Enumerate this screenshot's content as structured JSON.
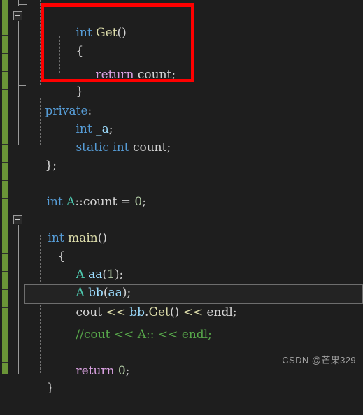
{
  "app": {
    "name": "visual-studio-code-editor",
    "theme": "dark",
    "background": "#1E1E1E"
  },
  "colors": {
    "background": "#1E1E1E",
    "keyword": "#569CD6",
    "function": "#DCDCAA",
    "class": "#4EC9B0",
    "identifier": "#D4D4D4",
    "variable": "#9CDCFE",
    "control_keyword": "#D8A0DF",
    "number": "#B5CEA8",
    "comment": "#57A64A",
    "annotation": "#FF0000",
    "changed_lines_marker": "#6A9437",
    "current_line_border": "#6E6E6E",
    "outline_marker": "#9A9A9A"
  },
  "gutter": {
    "change_marker_label": "unsaved-changes-bar",
    "outline_markers": [
      {
        "label": "collapse-class-A",
        "state": "expanded",
        "glyph": "minus"
      },
      {
        "label": "collapse-main",
        "state": "expanded",
        "glyph": "minus"
      }
    ]
  },
  "code": {
    "language": "cpp",
    "lines": [
      {
        "indent": 1,
        "text": "int Get()"
      },
      {
        "indent": 1,
        "text": "{"
      },
      {
        "indent": 2,
        "text": "return count;"
      },
      {
        "indent": 1,
        "text": "}"
      },
      {
        "indent": 0,
        "text": "private:"
      },
      {
        "indent": 1,
        "text": "int _a;"
      },
      {
        "indent": 1,
        "text": "static int count;"
      },
      {
        "indent": 0,
        "text": "};"
      },
      {
        "indent": 0,
        "text": ""
      },
      {
        "indent": 0,
        "text": "int A::count = 0;"
      },
      {
        "indent": 0,
        "text": ""
      },
      {
        "indent": 0,
        "text": "int main()"
      },
      {
        "indent": 0,
        "text": "{"
      },
      {
        "indent": 1,
        "text": "A aa(1);"
      },
      {
        "indent": 1,
        "text": "A bb(aa);"
      },
      {
        "indent": 1,
        "text": "cout << bb.Get() << endl;"
      },
      {
        "indent": 1,
        "text": "//cout << A:: << endl;"
      },
      {
        "indent": 0,
        "text": ""
      },
      {
        "indent": 1,
        "text": "return 0;"
      },
      {
        "indent": 0,
        "text": "}"
      }
    ],
    "tokens": {
      "l1": {
        "kw": "int",
        "sp1": " ",
        "fn": "Get",
        "pun": "()"
      },
      "l2": {
        "pun": "{"
      },
      "l3": {
        "ret": "return",
        "sp1": " ",
        "id": "count",
        "pun": ";"
      },
      "l4": {
        "pun": "}"
      },
      "l5": {
        "kw": "private",
        "pun": ":"
      },
      "l6": {
        "kw": "int",
        "sp1": " ",
        "var": "_a",
        "pun": ";"
      },
      "l7": {
        "kw1": "static",
        "sp1": " ",
        "kw2": "int",
        "sp2": " ",
        "id": "count",
        "pun": ";"
      },
      "l8": {
        "pun": "};"
      },
      "l10": {
        "kw": "int",
        "sp1": " ",
        "cls": "A",
        "pun1": "::",
        "id": "count",
        "pun2": " = ",
        "num": "0",
        "pun3": ";"
      },
      "l12": {
        "kw": "int",
        "sp1": " ",
        "fn": "main",
        "pun": "()"
      },
      "l13": {
        "pun": "{"
      },
      "l14": {
        "cls": "A",
        "sp1": " ",
        "var": "aa",
        "pun1": "(",
        "num": "1",
        "pun2": ");"
      },
      "l15": {
        "cls": "A",
        "sp1": " ",
        "var": "bb",
        "pun1": "(",
        "var2": "aa",
        "pun2": ");"
      },
      "l16": {
        "id1": "cout",
        "op1": " << ",
        "var": "bb",
        "dot": ".",
        "fn": "Get",
        "pun1": "()",
        "op2": " << ",
        "id2": "endl",
        "pun2": ";"
      },
      "l17": {
        "cmt": "//cout << A:: << endl;"
      },
      "l19": {
        "ret": "return",
        "sp1": " ",
        "num": "0",
        "pun": ";"
      },
      "l20": {
        "pun": "}"
      }
    }
  },
  "annotation": {
    "label": "red-highlight-rectangle",
    "covers": "int Get() { return count; }"
  },
  "current_line": {
    "label": "cout << bb.Get() << endl;"
  },
  "watermark": {
    "text": "CSDN @芒果329"
  }
}
